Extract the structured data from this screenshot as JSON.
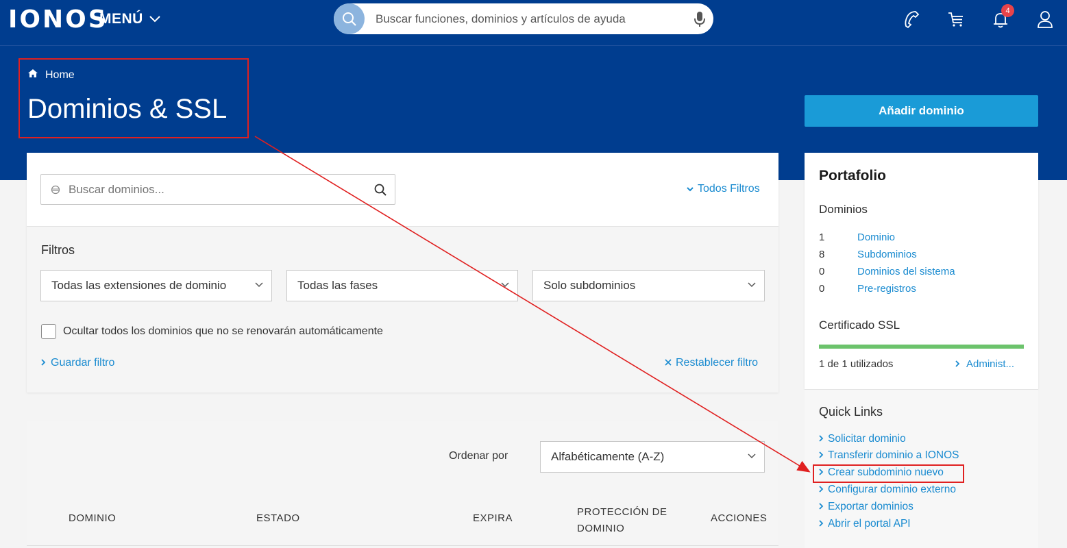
{
  "header": {
    "logo": "IONOS",
    "menu_label": "MENÚ",
    "search_placeholder": "Buscar funciones, dominios y artículos de ayuda",
    "notification_count": "4"
  },
  "hero": {
    "breadcrumb": "Home",
    "title": "Dominios & SSL",
    "add_domain_label": "Añadir dominio"
  },
  "search": {
    "placeholder": "Buscar dominios...",
    "all_filters": "Todos Filtros"
  },
  "filters": {
    "title": "Filtros",
    "extension_select": "Todas las extensiones de dominio",
    "phase_select": "Todas las fases",
    "type_select": "Solo subdominios",
    "hide_checkbox_label": "Ocultar todos los dominios que no se renovarán automáticamente",
    "save_filter": "Guardar filtro",
    "reset_filter": "Restablecer filtro"
  },
  "table": {
    "sort_label": "Ordenar por",
    "sort_value": "Alfabéticamente (A-Z)",
    "columns": [
      "DOMINIO",
      "ESTADO",
      "EXPIRA",
      "PROTECCIÓN DE",
      "DOMINIO",
      "ACCIONES"
    ]
  },
  "portfolio": {
    "title": "Portafolio",
    "domains_heading": "Dominios",
    "rows": [
      {
        "count": "1",
        "label": "Dominio"
      },
      {
        "count": "8",
        "label": "Subdominios"
      },
      {
        "count": "0",
        "label": "Dominios del sistema"
      },
      {
        "count": "0",
        "label": "Pre-registros"
      }
    ],
    "ssl_heading": "Certificado SSL",
    "ssl_progress_fraction": 1.0,
    "ssl_usage": "1 de 1 utilizados",
    "ssl_manage": "Administ..."
  },
  "quick_links": {
    "title": "Quick Links",
    "items": [
      "Solicitar dominio",
      "Transferir dominio a IONOS",
      "Crear subdominio nuevo",
      "Configurar dominio externo",
      "Exportar dominios",
      "Abrir el portal API"
    ]
  },
  "colors": {
    "brand_blue": "#003d8f",
    "accent_blue": "#1a9bd7",
    "link_blue": "#1a8bd0",
    "annotation_red": "#e02020",
    "progress_green": "#6cc36c"
  }
}
